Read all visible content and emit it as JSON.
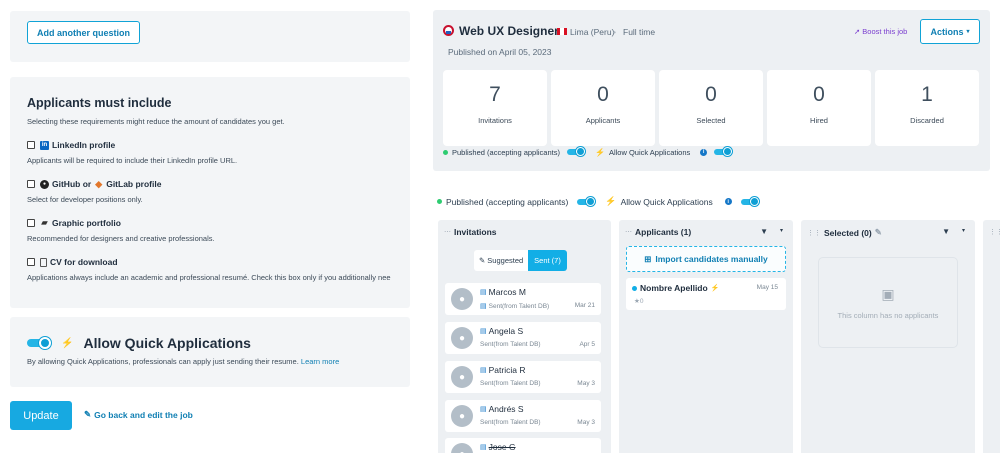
{
  "questions": {
    "add_label": "Add another question"
  },
  "requirements": {
    "title": "Applicants must include",
    "subtitle": "Selecting these requirements might reduce the amount of candidates you get.",
    "items": [
      {
        "label": "LinkedIn profile",
        "desc": "Applicants will be required to include their LinkedIn profile URL."
      },
      {
        "label": "GitHub or",
        "label2": "GitLab profile",
        "desc": "Select for developer positions only."
      },
      {
        "label": "Graphic portfolio",
        "desc": "Recommended for designers and creative professionals."
      },
      {
        "label": "CV for download",
        "desc": "Applications always include an academic and professional resumé. Check this box only if you additionally nee"
      }
    ]
  },
  "quick_apply": {
    "title": "Allow Quick Applications",
    "desc": "By allowing Quick Applications, professionals can apply just sending their resume.",
    "link": "Learn more"
  },
  "footer": {
    "update_label": "Update",
    "back_label": "Go back and edit the job"
  },
  "job": {
    "title": "Web UX Designer",
    "location": "Lima (Peru)",
    "separator": "•",
    "type": "Full time",
    "published": "Published on April 05, 2023",
    "boost_label": "Boost this job",
    "actions_label": "Actions",
    "stats": [
      {
        "value": "7",
        "label": "Invitations"
      },
      {
        "value": "0",
        "label": "Applicants"
      },
      {
        "value": "0",
        "label": "Selected"
      },
      {
        "value": "0",
        "label": "Hired"
      },
      {
        "value": "1",
        "label": "Discarded"
      }
    ],
    "status_label": "Published (accepting applicants)",
    "quick_label": "Allow Quick Applications"
  },
  "board": {
    "invitations": {
      "title": "Invitations",
      "tab_suggested": "Suggested",
      "tab_sent": "Sent (7)",
      "cards": [
        {
          "name": "Marcos M",
          "source": "Sent(from Talent DB)",
          "date": "Mar 21"
        },
        {
          "name": "Angela S",
          "source": "Sent(from Talent DB)",
          "date": "Apr 5"
        },
        {
          "name": "Patricia R",
          "source": "Sent(from Talent DB)",
          "date": "May 3"
        },
        {
          "name": "Andrés S",
          "source": "Sent(from Talent DB)",
          "date": "May 3"
        },
        {
          "name": "Jose G",
          "source": "",
          "date": ""
        }
      ]
    },
    "applicants": {
      "title": "Applicants (1)",
      "import_label": "Import candidates manually",
      "card": {
        "name": "Nombre Apellido",
        "date": "May 15",
        "stars": "0"
      }
    },
    "selected": {
      "title": "Selected (0)",
      "empty_text": "This column has no applicants"
    },
    "hired": {
      "title": "H"
    }
  }
}
